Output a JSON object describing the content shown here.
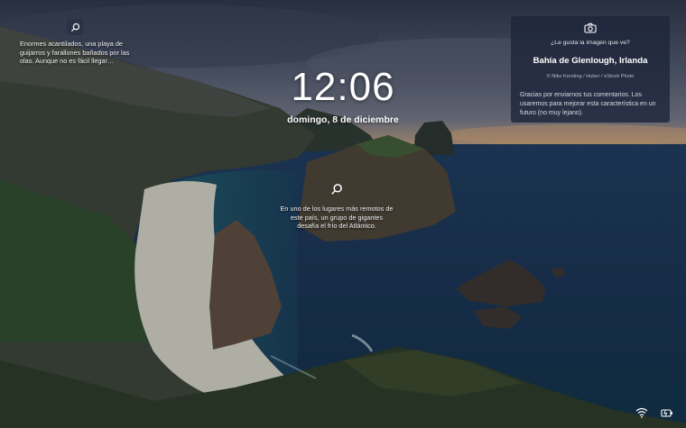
{
  "clock": {
    "time": "12:06",
    "date": "domingo, 8 de diciembre"
  },
  "hotspots": [
    {
      "icon": "search-icon",
      "lines": [
        "Enormes acantilados, una playa de",
        "guijarros y farallones bañados por las",
        "olas. Aunque no es fácil llegar…"
      ]
    },
    {
      "icon": "search-icon",
      "lines": [
        "En uno de los lugares más remotos de",
        "este país, un grupo de gigantes",
        "desafía el frío del Atlántico."
      ]
    }
  ],
  "info_card": {
    "icon": "camera-icon",
    "question": "¿Le gusta la imagen que ve?",
    "title": "Bahía de Glenlough, Irlanda",
    "credit": "© Niko Kersting / Huber / eStock Photo",
    "body_lines": [
      "Gracias por enviarnos tus comentarios. Los",
      "usaremos para mejorar esta característica en un",
      "futuro (no muy lejano)."
    ]
  },
  "tray": {
    "icons": [
      "wifi-icon",
      "battery-icon"
    ]
  }
}
